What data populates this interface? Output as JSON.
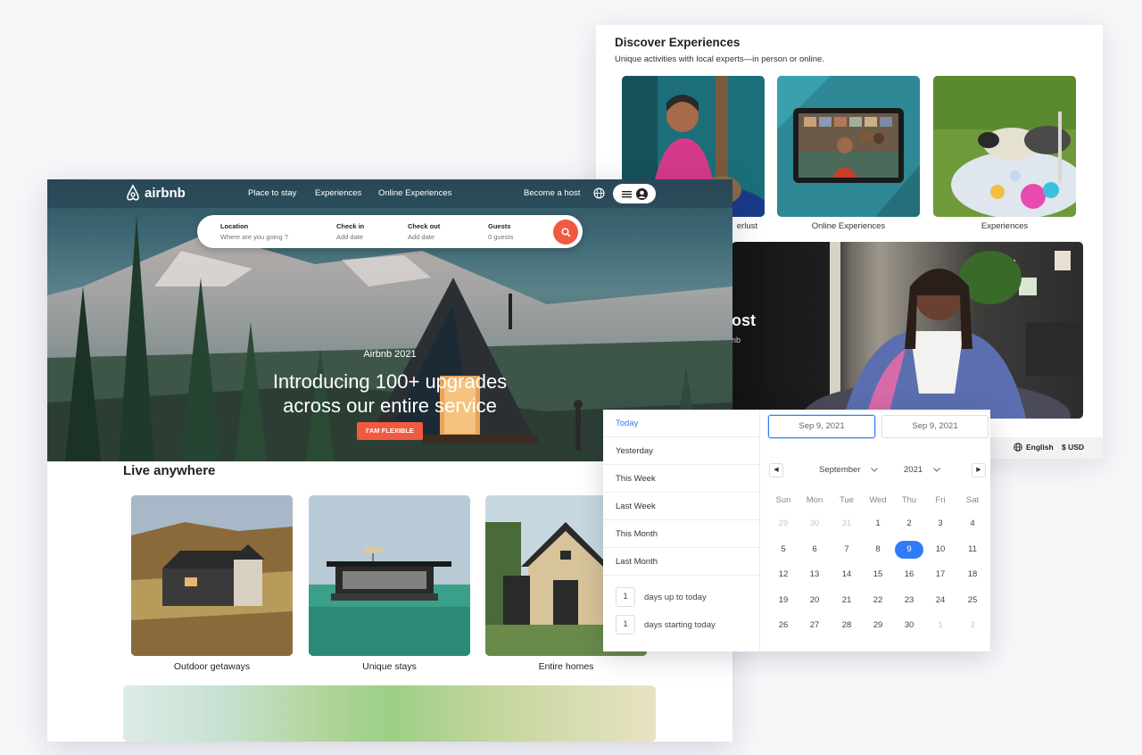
{
  "discover": {
    "title": "Discover Experiences",
    "subtitle": "Unique activities with local experts—in person or online.",
    "cards": [
      {
        "label": "Online Experiences"
      },
      {
        "label": "Experiences"
      }
    ],
    "partial_label": "erlust",
    "banner_text": "ost",
    "banner_sub": "nb",
    "footer": {
      "language": "English",
      "currency": "$ USD"
    }
  },
  "airbnb": {
    "logo": "airbnb",
    "nav": [
      "Place to stay",
      "Experiences",
      "Online Experiences"
    ],
    "become_host": "Become a host",
    "search": {
      "location_label": "Location",
      "location_placeholder": "Where are you going ?",
      "checkin_label": "Check in",
      "checkin_value": "Add date",
      "checkout_label": "Check out",
      "checkout_value": "Add date",
      "guests_label": "Guests",
      "guests_value": "0 guests"
    },
    "hero": {
      "eyebrow": "Airbnb 2021",
      "line1": "Introducing 100+ upgrades",
      "line2": "across our entire service",
      "cta": "I'AM FLEXIBLE"
    },
    "section_title": "Live anywhere",
    "cards": [
      {
        "label": "Outdoor getaways"
      },
      {
        "label": "Unique stays"
      },
      {
        "label": "Entire homes"
      }
    ]
  },
  "datepicker": {
    "presets": [
      "Today",
      "Yesterday",
      "This Week",
      "Last Week",
      "This Month",
      "Last Month"
    ],
    "active_preset": "Today",
    "custom": [
      {
        "value": "1",
        "label": "days up to today"
      },
      {
        "value": "1",
        "label": "days starting today"
      }
    ],
    "start_date": "Sep 9, 2021",
    "end_date": "Sep 9, 2021",
    "month": "September",
    "year": "2021",
    "weekdays": [
      "Sun",
      "Mon",
      "Tue",
      "Wed",
      "Thu",
      "Fri",
      "Sat"
    ],
    "weeks": [
      [
        "29",
        "30",
        "31",
        "1",
        "2",
        "3",
        "4"
      ],
      [
        "5",
        "6",
        "7",
        "8",
        "9",
        "10",
        "11"
      ],
      [
        "12",
        "13",
        "14",
        "15",
        "16",
        "17",
        "18"
      ],
      [
        "19",
        "20",
        "21",
        "22",
        "23",
        "24",
        "25"
      ],
      [
        "26",
        "27",
        "28",
        "29",
        "30",
        "1",
        "2"
      ]
    ],
    "selected_day": "9",
    "accent": "#2f7cf6"
  }
}
